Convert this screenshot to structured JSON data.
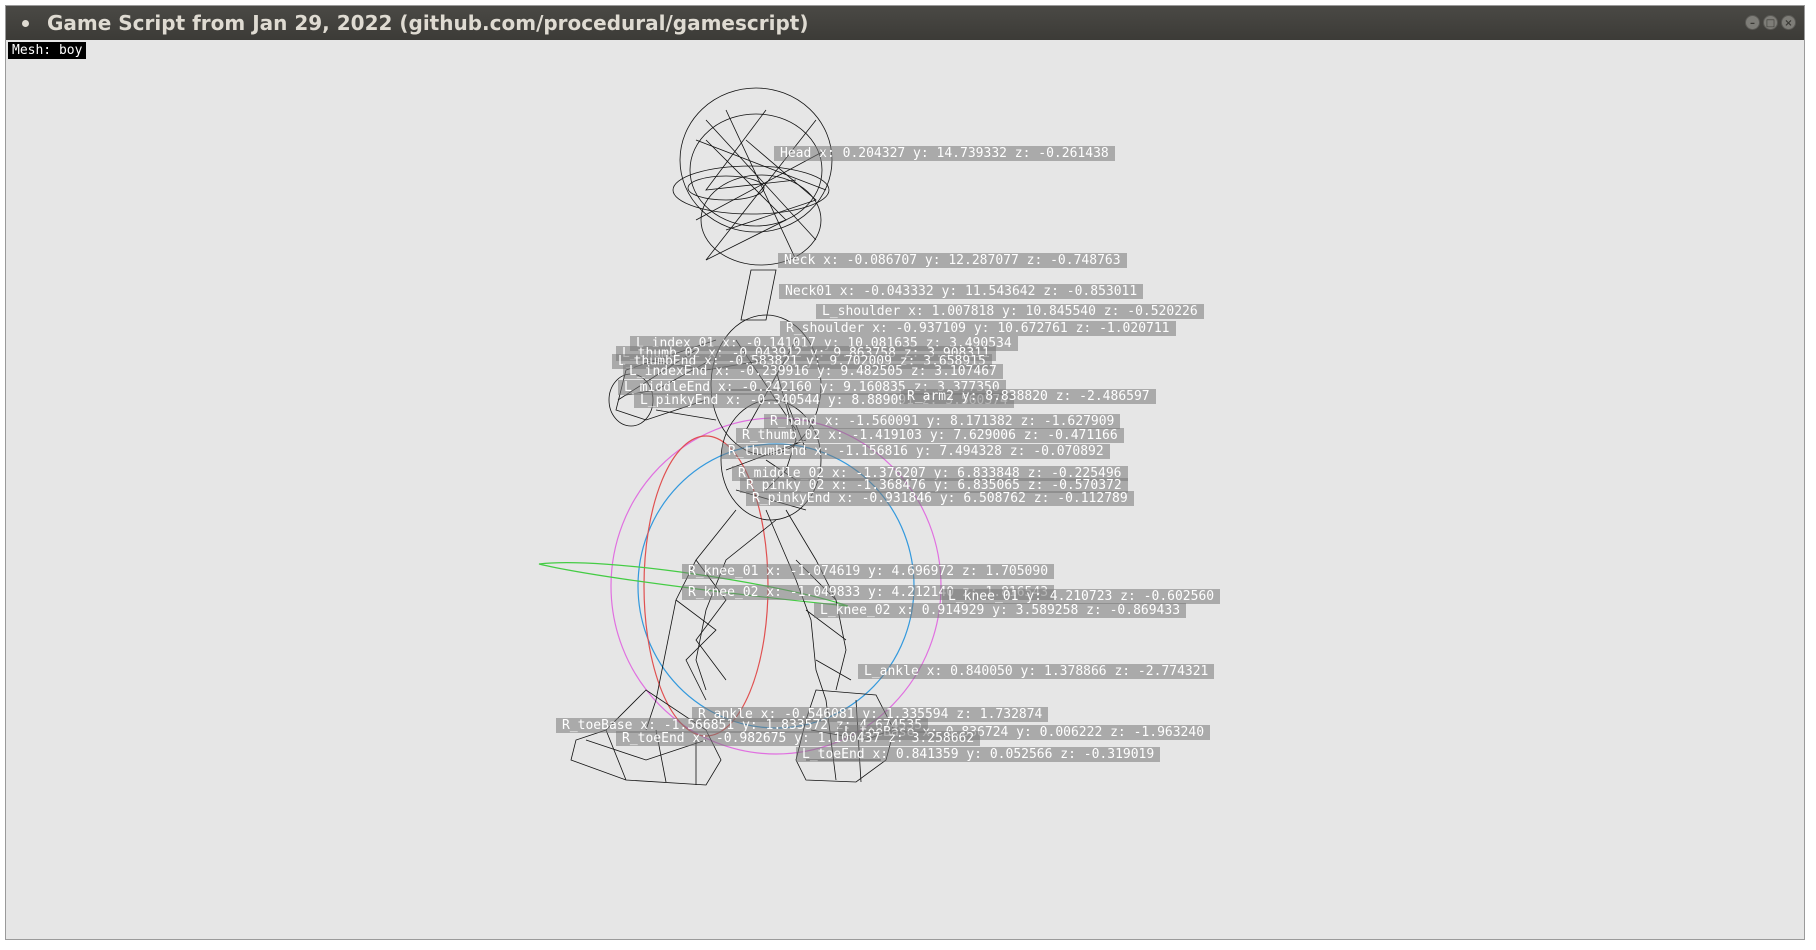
{
  "window": {
    "title": "Game Script from Jan 29, 2022 (github.com/procedural/gamescript)",
    "controls": [
      "minimize-icon",
      "maximize-icon",
      "close-icon"
    ]
  },
  "viewport": {
    "mesh_label": "Mesh: boy",
    "gizmo_colors": {
      "outer": "#e070e0",
      "blue": "#3399dd",
      "red": "#e05050",
      "green": "#44cc44"
    },
    "bones": [
      {
        "text": "Head x: 0.204327 y: 14.739332 z: -0.261438"
      },
      {
        "text": "Neck x: -0.086707 y: 12.287077 z: -0.748763"
      },
      {
        "text": "Neck01 x: -0.043332 y: 11.543642 z: -0.853011"
      },
      {
        "text": "L_shoulder x: 1.007818 y: 10.845540 z: -0.520226"
      },
      {
        "text": "R_shoulder x: -0.937109 y: 10.672761 z: -1.020711"
      },
      {
        "text": "L_index_01 x: -0.141017 y: 10.081635 z: 3.490534"
      },
      {
        "text": "L_thumb_02 x: -0.043912 y: 9.863758 z: 3.908311"
      },
      {
        "text": "L_thumbEnd x: -0.583821 y: 9.702009 z: 3.658915"
      },
      {
        "text": "L_indexEnd x: -0.239916 y: 9.482505 z: 3.107467"
      },
      {
        "text": "L_middleEnd x: -0.242160 y: 9.160835 z: 3.377350"
      },
      {
        "text": "L_pinkyEnd x: -0.340544 y: 8.889091 z: 3.560374"
      },
      {
        "text": "R_arm2 y: 8.838820 z: -2.486597"
      },
      {
        "text": "R_hand x: -1.560091 y: 8.171382 z: -1.627909"
      },
      {
        "text": "R_thumb_02 x: -1.419103 y: 7.629006 z: -0.471166"
      },
      {
        "text": "R_thumbEnd x: -1.156816 y: 7.494328 z: -0.070892"
      },
      {
        "text": "R_middle_02 x: -1.376207 y: 6.833848 z: -0.225496"
      },
      {
        "text": "R_pinky_02 x: -1.368476 y: 6.835065 z: -0.570372"
      },
      {
        "text": "R_pinkyEnd x: -0.931846 y: 6.508762 z: -0.112789"
      },
      {
        "text": "R_knee_01 x: -1.074619 y: 4.696972 z: 1.705090"
      },
      {
        "text": "R_knee_02 x: -1.049833 y: 4.212140 z: 1.816543"
      },
      {
        "text": "L_knee_01 y: 4.210723 z: -0.602560"
      },
      {
        "text": "L_knee_02 x: 0.914929 y: 3.589258 z: -0.869433"
      },
      {
        "text": "L_ankle x: 0.840050 y: 1.378866 z: -2.774321"
      },
      {
        "text": "R_ankle x: -0.546081 y: 1.335594 z: 1.732874"
      },
      {
        "text": "R_toeBase x: -1.566851 y: 1.833572 z: 4.674535"
      },
      {
        "text": "L_toeBase x: 0.836724 y: 0.006222 z: -1.963240"
      },
      {
        "text": "R_toeEnd x: -0.982675 y: 1.100437 z: 3.258662"
      },
      {
        "text": "L_toeEnd x: 0.841359 y: 0.052566 z: -0.319019"
      }
    ]
  }
}
